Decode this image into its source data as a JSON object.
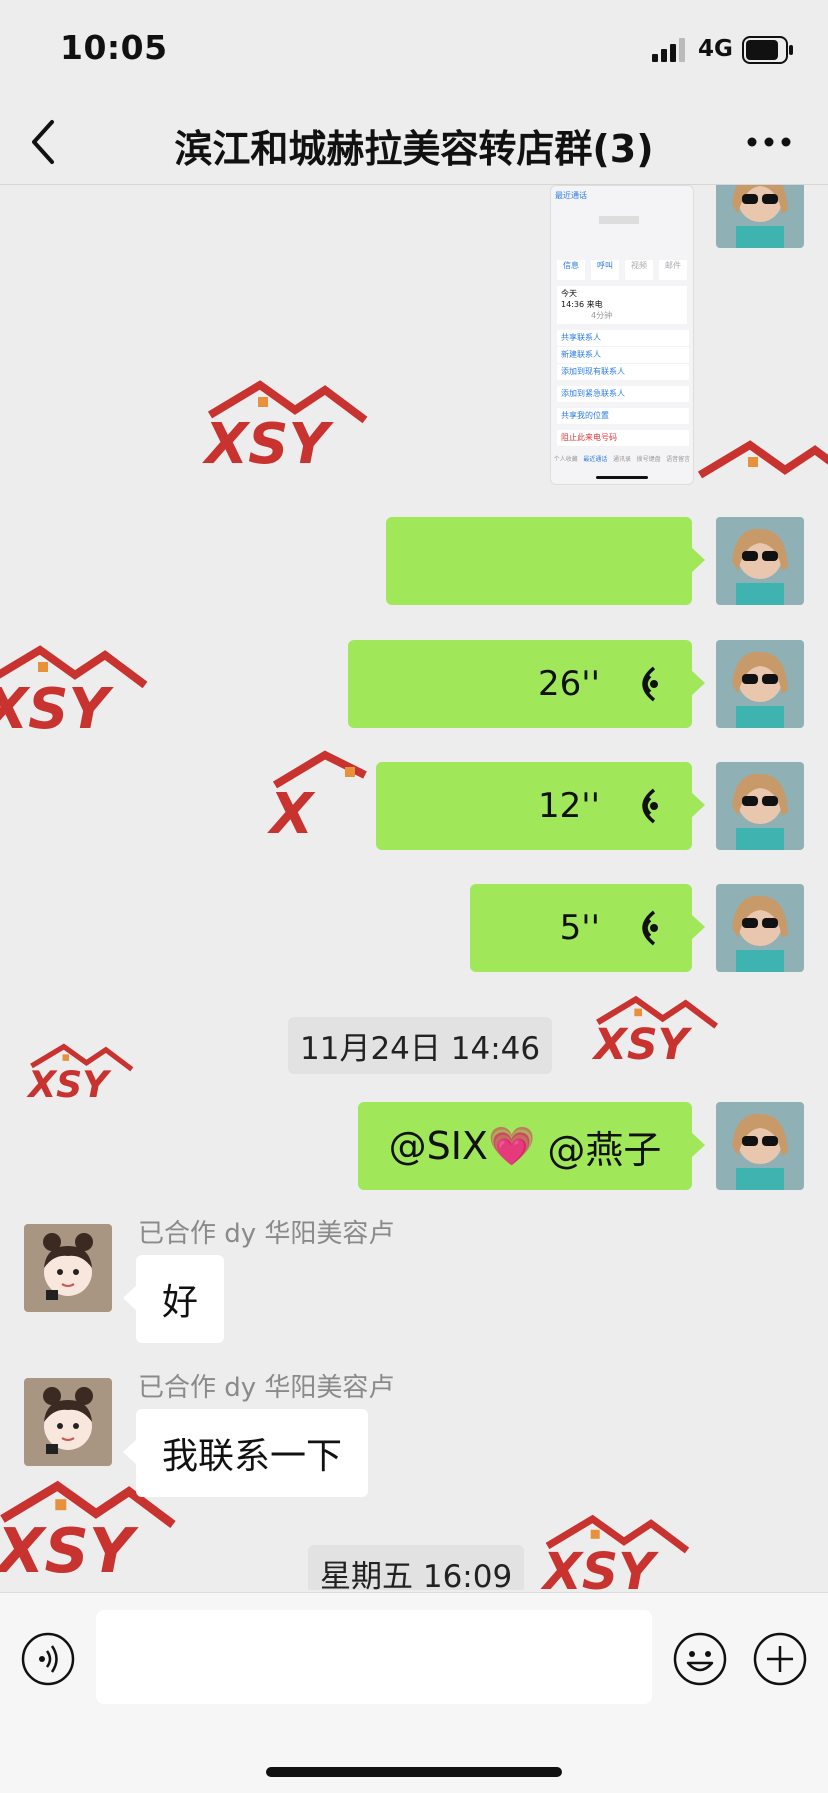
{
  "status": {
    "time": "10:05",
    "network": "4G"
  },
  "nav": {
    "title": "滨江和城赫拉美容转店群(3)"
  },
  "shared_screenshot": {
    "back_label": "最近通话",
    "buttons": [
      "信息",
      "呼叫",
      "视频",
      "邮件"
    ],
    "call_day": "今天",
    "call_time": "14:36 来电",
    "call_note": "4分钟",
    "actions": [
      "共享联系人",
      "新建联系人",
      "添加到现有联系人",
      "添加到紧急联系人",
      "共享我的位置",
      "阻止此来电号码"
    ],
    "tabs": [
      "个人收藏",
      "最近通话",
      "通讯录",
      "拨号键盘",
      "语音留言"
    ]
  },
  "messages": [
    {
      "voice_duration": "26''"
    },
    {
      "voice_duration": "12''"
    },
    {
      "voice_duration": "5''"
    }
  ],
  "timestamp_1": "11月24日 14:46",
  "mention_message": {
    "prefix": "@SIX",
    "heart": "💗",
    "suffix": " @燕子"
  },
  "incoming": [
    {
      "sender": "已合作 dy 华阳美容卢",
      "text": "好"
    },
    {
      "sender": "已合作 dy 华阳美容卢",
      "text": "我联系一下"
    }
  ],
  "timestamp_2": "星期五 16:09",
  "watermark": "XSY",
  "colors": {
    "bubble_out": "#a0e75a",
    "bubble_in": "#ffffff",
    "background": "#ededed",
    "watermark": "#c8322f"
  },
  "icons": [
    "back-icon",
    "more-icon",
    "voice-wave-icon",
    "voice-input-icon",
    "emoji-icon",
    "plus-icon"
  ]
}
